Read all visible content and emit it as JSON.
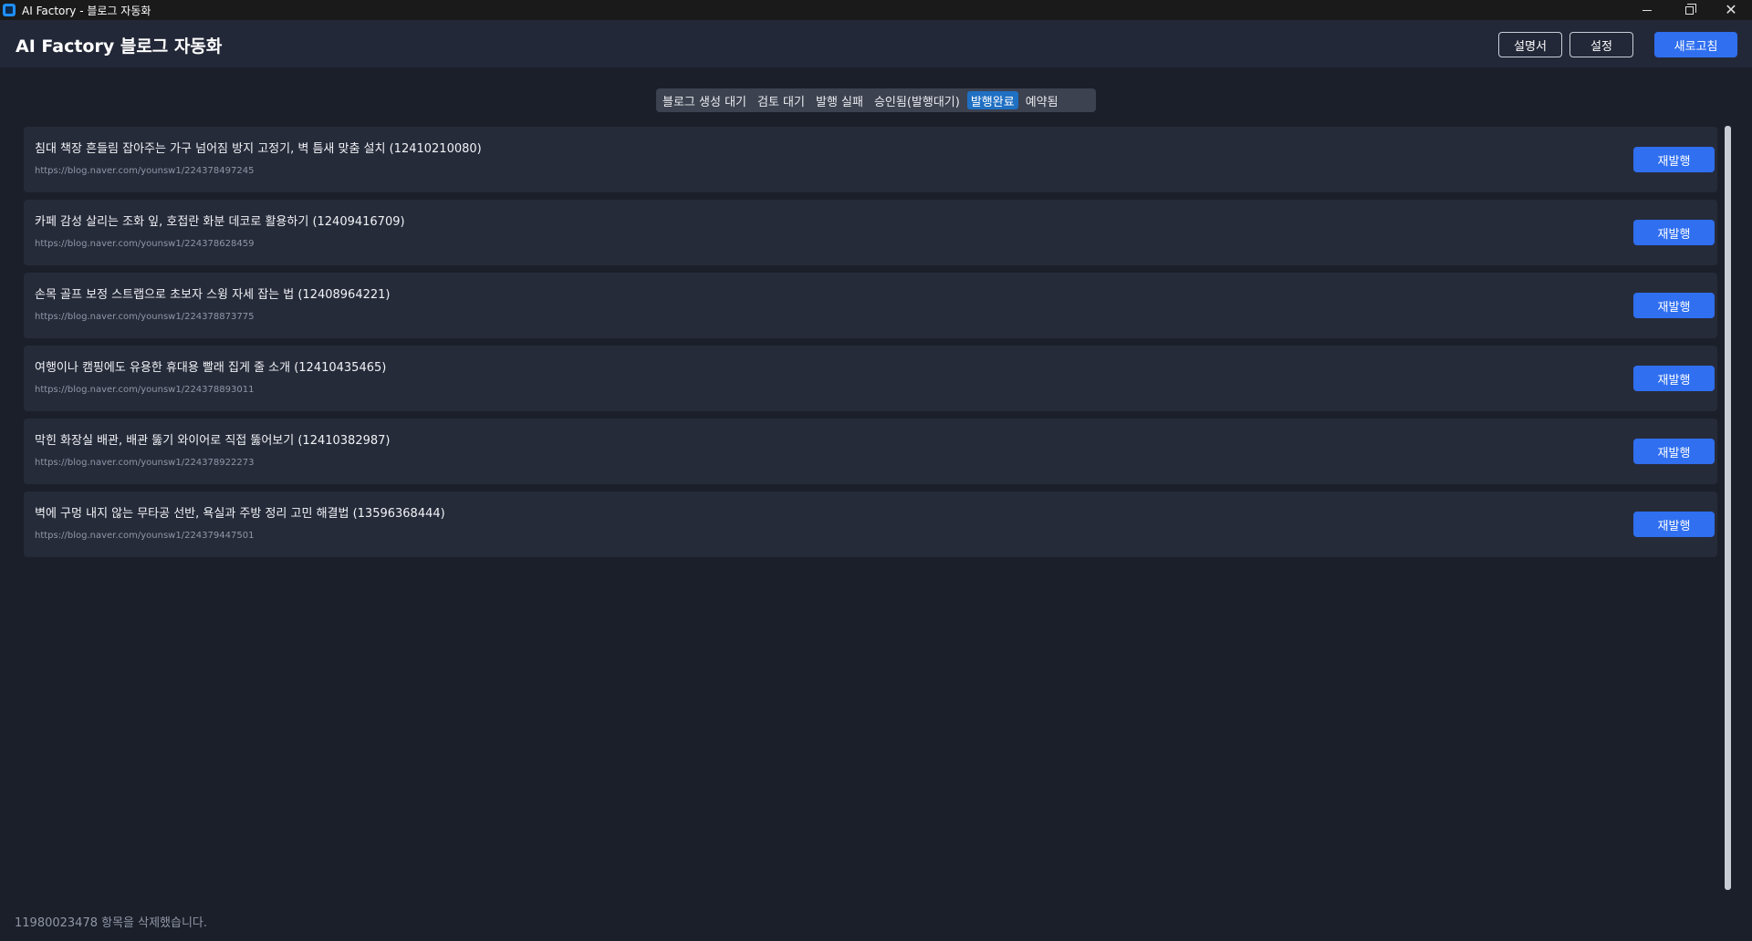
{
  "window": {
    "title": "AI Factory - 블로그 자동화",
    "controls": {
      "minimize": "",
      "maximize": "",
      "close": "✕"
    }
  },
  "header": {
    "title": "AI Factory 블로그 자동화",
    "manual_label": "설명서",
    "settings_label": "설정",
    "refresh_label": "새로고침"
  },
  "tabs": [
    {
      "label": "블로그 생성 대기",
      "active": false
    },
    {
      "label": "검토 대기",
      "active": false
    },
    {
      "label": "발행 실패",
      "active": false
    },
    {
      "label": "승인됨(발행대기)",
      "active": false
    },
    {
      "label": "발행완료",
      "active": true
    },
    {
      "label": "예약됨",
      "active": false
    }
  ],
  "items": [
    {
      "title": "침대 책장 흔들림 잡아주는 가구 넘어짐 방지 고정기, 벽 틈새 맞춤 설치 (12410210080)",
      "url": "https://blog.naver.com/younsw1/224378497245",
      "button": "재발행"
    },
    {
      "title": "카페 감성 살리는 조화 잎, 호접란 화분 데코로 활용하기 (12409416709)",
      "url": "https://blog.naver.com/younsw1/224378628459",
      "button": "재발행"
    },
    {
      "title": "손목 골프 보정 스트랩으로 초보자 스윙 자세 잡는 법 (12408964221)",
      "url": "https://blog.naver.com/younsw1/224378873775",
      "button": "재발행"
    },
    {
      "title": "여행이나 캠핑에도 유용한 휴대용 빨래 집게 줄 소개 (12410435465)",
      "url": "https://blog.naver.com/younsw1/224378893011",
      "button": "재발행"
    },
    {
      "title": "막힌 화장실 배관, 배관 뚫기 와이어로 직접 뚫어보기 (12410382987)",
      "url": "https://blog.naver.com/younsw1/224378922273",
      "button": "재발행"
    },
    {
      "title": "벽에 구멍 내지 않는 무타공 선반, 욕실과 주방 정리 고민 해결법 (13596368444)",
      "url": "https://blog.naver.com/younsw1/224379447501",
      "button": "재발행"
    }
  ],
  "status": {
    "message": "11980023478 항목을 삭제했습니다."
  },
  "colors": {
    "background": "#1b1f2a",
    "header": "#232838",
    "card": "#262b3a",
    "accent": "#2f6ff0",
    "active_tab": "#1f6fc2"
  }
}
